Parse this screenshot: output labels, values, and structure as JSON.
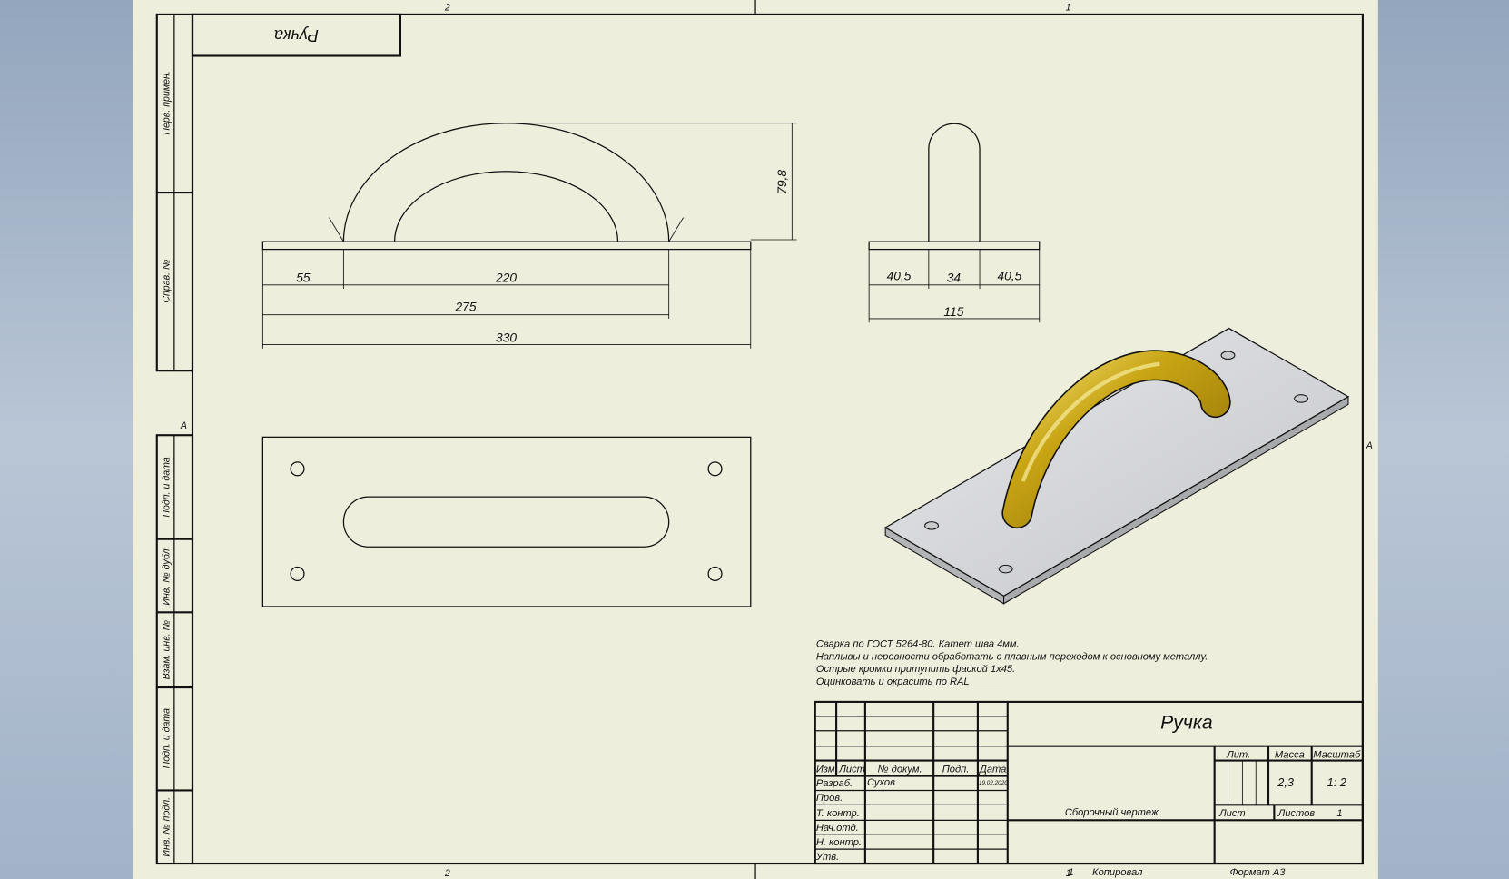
{
  "colors": {
    "sheet": "#eeeedd",
    "background": "#a9b8cc",
    "handle": "#c9a514",
    "plate": "#d2d3d6"
  },
  "zones": {
    "top_left": "2",
    "top_right": "1",
    "bottom_left": "2",
    "bottom_right": "1",
    "left": "A",
    "right": "A"
  },
  "corner_stamp": "Ручка",
  "side_strip": [
    "Перв. примен.",
    "Справ. №",
    "Подп. и дата",
    "Инв. № дубл.",
    "Взам. инв. №",
    "Подп. и дата",
    "Инв. № подл."
  ],
  "front_view": {
    "height_dim": "79,8",
    "dims": [
      "55",
      "220",
      "275",
      "330"
    ]
  },
  "side_view": {
    "dims": [
      "40,5",
      "34",
      "40,5",
      "115"
    ]
  },
  "notes": [
    "Сварка по ГОСТ 5264-80. Катет шва 4мм.",
    "Наплывы и неровности обработать с плавным переходом к основному металлу.",
    "Острые кромки притупить фаской 1х45.",
    "Оцинковать и окрасить по RAL______"
  ],
  "title_block": {
    "name": "Ручка",
    "doc_type": "Сборочный чертеж",
    "header": [
      "Изм.",
      "Лист",
      "№ докум.",
      "Подп.",
      "Дата"
    ],
    "roles": [
      "Разраб.",
      "Пров.",
      "Т. контр.",
      "Нач.отд.",
      "Н. контр.",
      "Утв."
    ],
    "developer": "Сухов",
    "date": "19.02.2020",
    "lit_label": "Лит.",
    "mass_label": "Масса",
    "scale_label": "Масштаб",
    "mass": "2,3",
    "scale": "1: 2",
    "sheet_label": "Лист",
    "sheets_label": "Листов",
    "sheets": "1"
  },
  "footer": {
    "number": "1",
    "copied": "Копировал",
    "format": "Формат А3"
  }
}
